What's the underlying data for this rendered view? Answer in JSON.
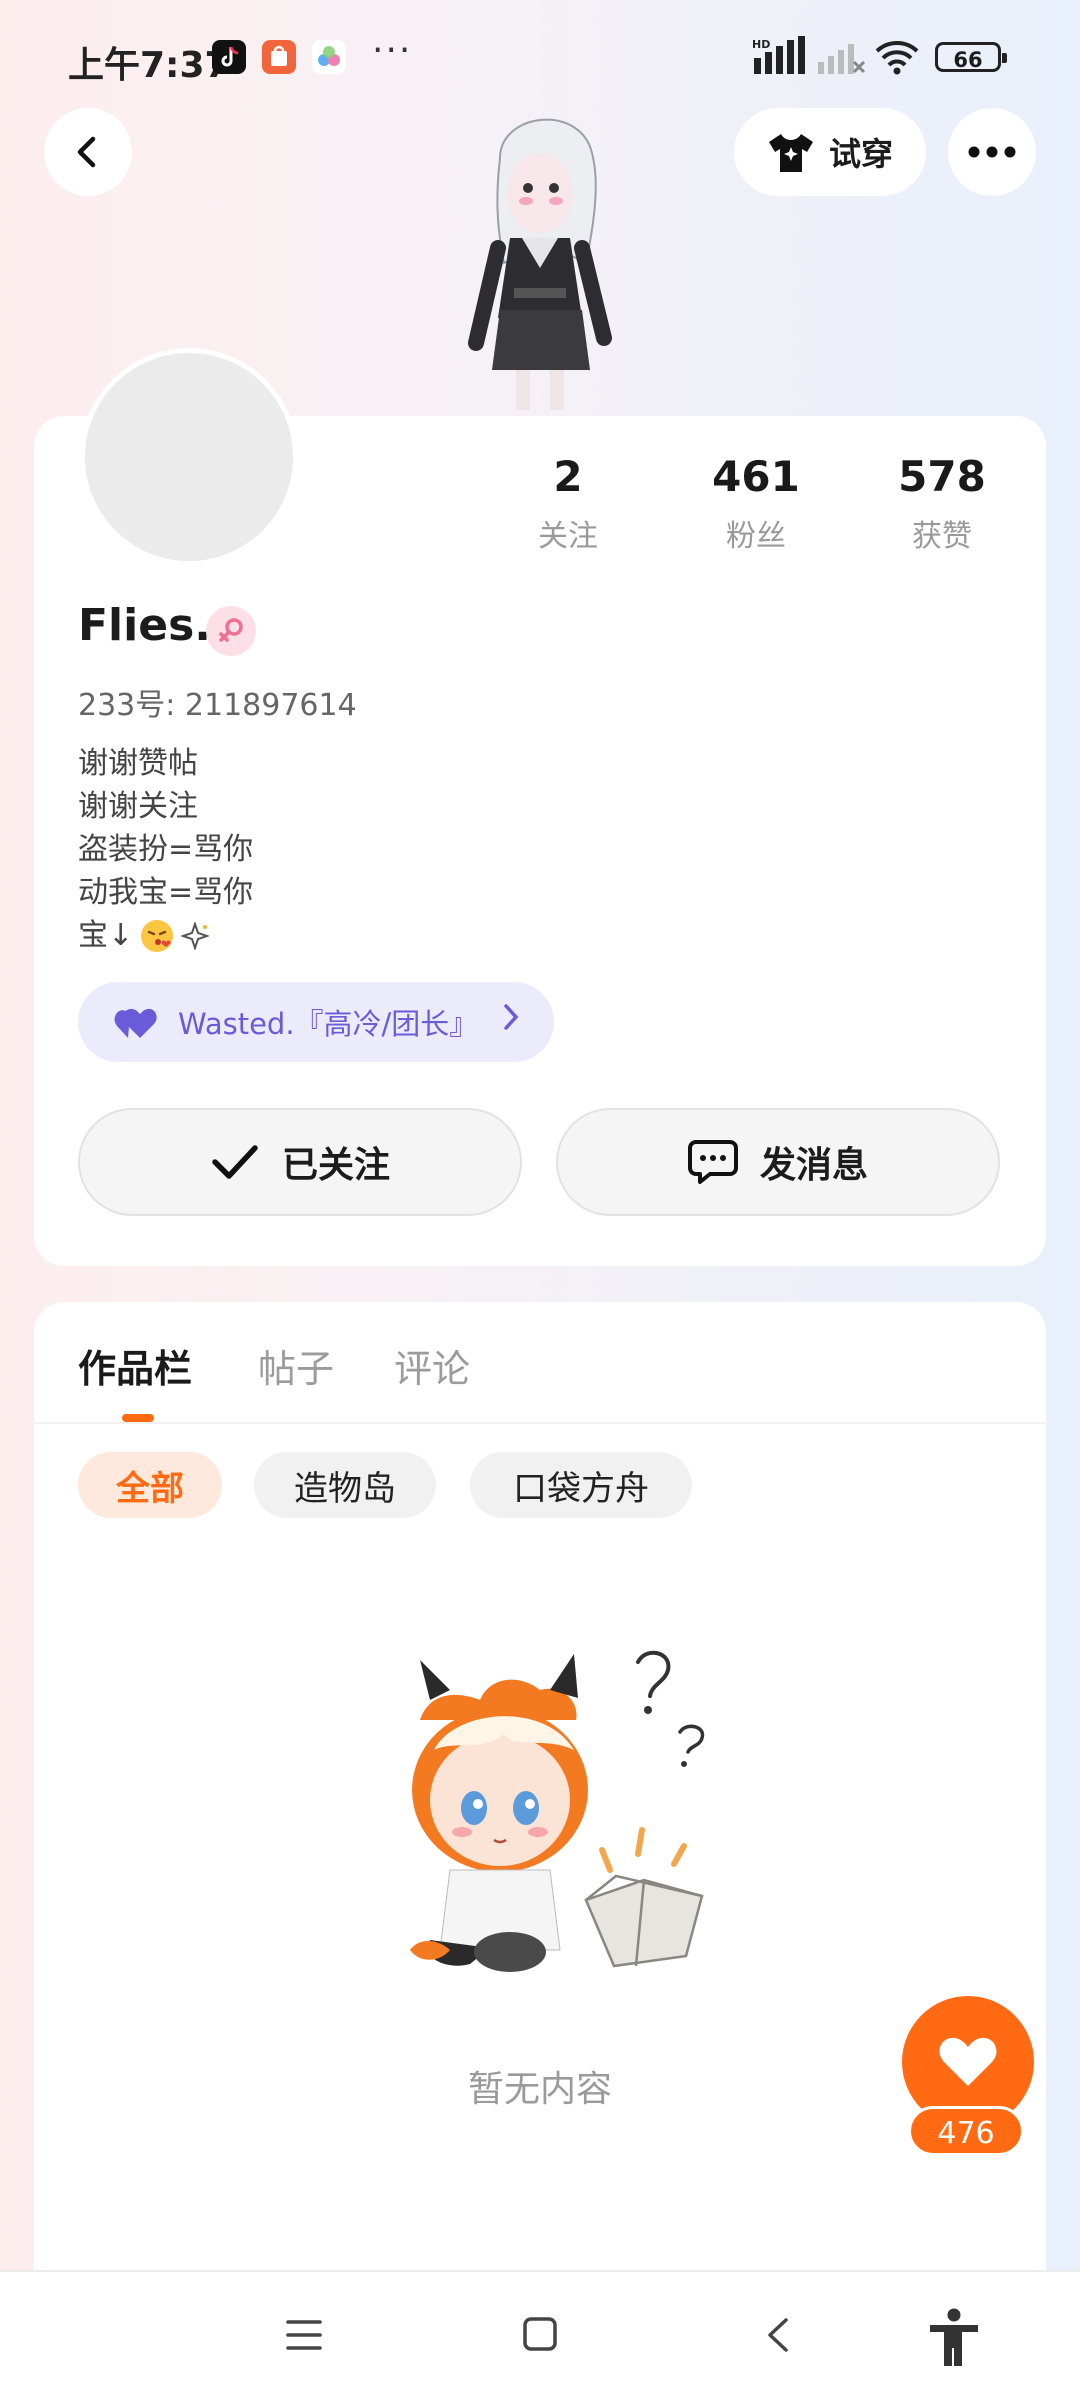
{
  "status_bar": {
    "time": "上午7:37",
    "more_dots": "···",
    "signal_label": "HD",
    "battery": "66"
  },
  "header": {
    "try_on_label": "试穿"
  },
  "profile": {
    "stats": [
      {
        "value": "2",
        "label": "关注"
      },
      {
        "value": "461",
        "label": "粉丝"
      },
      {
        "value": "578",
        "label": "获赞"
      }
    ],
    "name": "Flies.",
    "uid": "233号: 211897614",
    "bio": [
      "谢谢赞帖",
      "谢谢关注",
      "盗装扮=骂你",
      "动我宝=骂你",
      "宝↓"
    ],
    "team_label": "Wasted.『高冷/团长』",
    "follow_button": "已关注",
    "message_button": "发消息"
  },
  "works": {
    "tabs": [
      "作品栏",
      "帖子",
      "评论"
    ],
    "chips": [
      "全部",
      "造物岛",
      "口袋方舟"
    ],
    "empty_text": "暂无内容"
  },
  "like_count": "476",
  "colors": {
    "accent": "#ff6a13",
    "team_purple": "#6a5bd8",
    "gender_pink": "#f06e92"
  }
}
